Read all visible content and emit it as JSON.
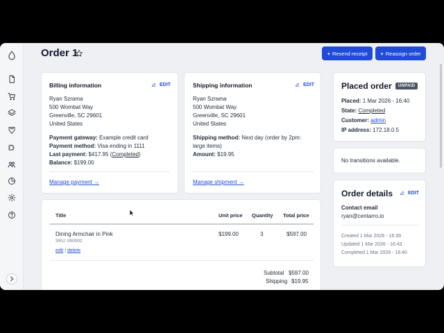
{
  "page": {
    "title": "Order 1",
    "buttons": {
      "resend_receipt": "Resend receipt",
      "reassign_order": "Reassign order"
    }
  },
  "sidebar": {
    "icons": [
      "logo-drop-icon",
      "document-icon",
      "cart-icon",
      "layers-icon",
      "tag-icon",
      "puzzle-icon",
      "users-icon",
      "chart-icon",
      "gear-icon",
      "help-icon"
    ]
  },
  "billing": {
    "title": "Billing information",
    "edit": "EDIT",
    "name": "Ryan Szrama",
    "address1": "500 Wombat Way",
    "address2": "Greenville, SC 29601",
    "country": "United States",
    "gateway_label": "Payment gateway:",
    "gateway_value": "Example credit card",
    "method_label": "Payment method:",
    "method_value": "Visa ending in 1111",
    "last_label": "Last payment:",
    "last_value": "$417.95",
    "last_status": "Completed",
    "balance_label": "Balance:",
    "balance_value": "$199.00",
    "manage": "Manage payment →"
  },
  "shipping": {
    "title": "Shipping information",
    "edit": "EDIT",
    "name": "Ryan Szrama",
    "address1": "500 Wombat Way",
    "address2": "Greenville, SC 29601",
    "country": "United States",
    "method_label": "Shipping method:",
    "method_value_line1": "Next day (order by 2pm:",
    "method_value_line2": "large items)",
    "amount_label": "Amount:",
    "amount_value": "$19.95",
    "manage": "Manage shipment →"
  },
  "placed": {
    "title": "Placed order",
    "badge": "UNPAID",
    "placed_label": "Placed:",
    "placed_value": "1 Mar 2026 - 16:40",
    "state_label": "State:",
    "state_value": "Completed",
    "customer_label": "Customer:",
    "customer_value": "admin",
    "ip_label": "IP address:",
    "ip_value": "172.18.0.5"
  },
  "transitions": {
    "text": "No transitions available."
  },
  "details": {
    "title": "Order details",
    "edit": "EDIT",
    "contact_label": "Contact email",
    "contact_value": "ryan@centarro.io",
    "created": "Created 1 Mar 2026 - 16:39",
    "updated": "Updated 1 Mar 2026 - 16:43",
    "completed": "Completed 1 Mar 2026 - 16:40"
  },
  "items": {
    "headers": {
      "title": "Title",
      "unit_price": "Unit price",
      "quantity": "Quantity",
      "total_price": "Total price"
    },
    "rows": [
      {
        "title": "Dining Armchair in Pink",
        "sku": "SKU: 000002",
        "unit_price": "$199.00",
        "quantity": "3",
        "total_price": "$597.00",
        "edit": "edit",
        "sep": "|",
        "delete": "delete"
      }
    ],
    "subtotal_label": "Subtotal",
    "subtotal_value": "$597.00",
    "shipping_label": "Shipping",
    "shipping_value": "$19.95"
  }
}
